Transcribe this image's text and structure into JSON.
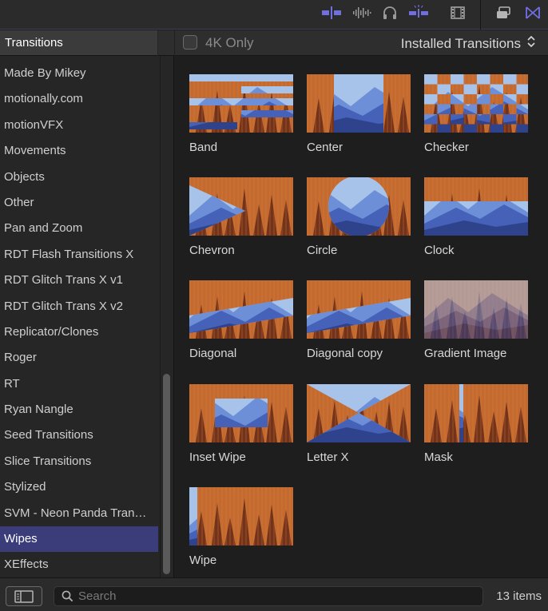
{
  "toolbar": {
    "icons": [
      "clip-connect-icon",
      "audio-waveform-icon",
      "headphones-icon",
      "skimming-icon",
      "filmstrip-icon",
      "window-stack-icon",
      "transitions-icon"
    ]
  },
  "sidebar": {
    "header": "Transitions",
    "items": [
      "Made By Mikey",
      "motionally.com",
      "motionVFX",
      "Movements",
      "Objects",
      "Other",
      "Pan and Zoom",
      "RDT Flash Transitions X",
      "RDT Glitch Trans X v1",
      "RDT Glitch Trans X v2",
      "Replicator/Clones",
      "Roger",
      "RT",
      "Ryan Nangle",
      "Seed Transitions",
      "Slice Transitions",
      "Stylized",
      "SVM - Neon Panda Tran…",
      "Wipes",
      "XEffects"
    ],
    "selected_index": 18
  },
  "main": {
    "filter_label": "4K Only",
    "source_label": "Installed Transitions",
    "tiles": [
      {
        "label": "Band",
        "pattern": "band"
      },
      {
        "label": "Center",
        "pattern": "center"
      },
      {
        "label": "Checker",
        "pattern": "checker"
      },
      {
        "label": "Chevron",
        "pattern": "chevron"
      },
      {
        "label": "Circle",
        "pattern": "circle"
      },
      {
        "label": "Clock",
        "pattern": "clock"
      },
      {
        "label": "Diagonal",
        "pattern": "diagonal"
      },
      {
        "label": "Diagonal copy",
        "pattern": "diagonal"
      },
      {
        "label": "Gradient Image",
        "pattern": "gradient"
      },
      {
        "label": "Inset Wipe",
        "pattern": "inset"
      },
      {
        "label": "Letter X",
        "pattern": "letterx"
      },
      {
        "label": "Mask",
        "pattern": "mask"
      },
      {
        "label": "Wipe",
        "pattern": "wipe"
      }
    ]
  },
  "bottom": {
    "search_placeholder": "Search",
    "count": "13 items"
  },
  "colors": {
    "accent": "#3a3d7a",
    "icon_blue": "#6f6fe0",
    "forest_orange": "#c0672e",
    "mountain_blue": "#4a6bc4"
  }
}
